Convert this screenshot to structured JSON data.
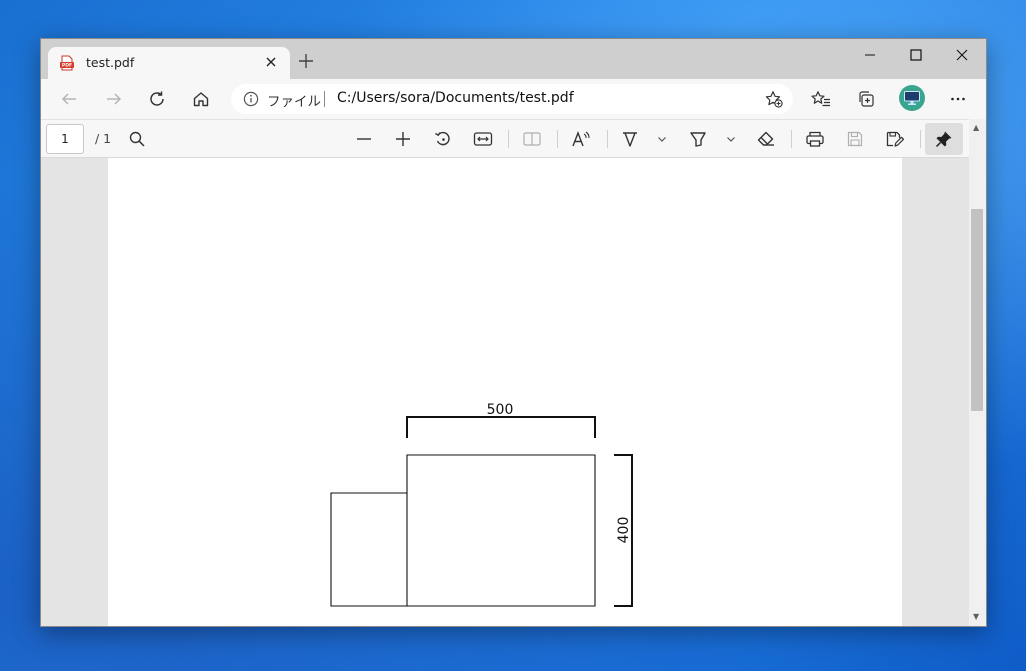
{
  "tab": {
    "title": "test.pdf",
    "favicon_label": "PDF"
  },
  "address": {
    "scheme_label": "ファイル",
    "url": "C:/Users/sora/Documents/test.pdf"
  },
  "pdf_toolbar": {
    "page_number": "1",
    "page_total": "/ 1"
  },
  "drawing": {
    "width_dimension": "500",
    "height_dimension": "400"
  },
  "colors": {
    "profile": "#3aa58f",
    "favicon": "#d83a2a"
  }
}
